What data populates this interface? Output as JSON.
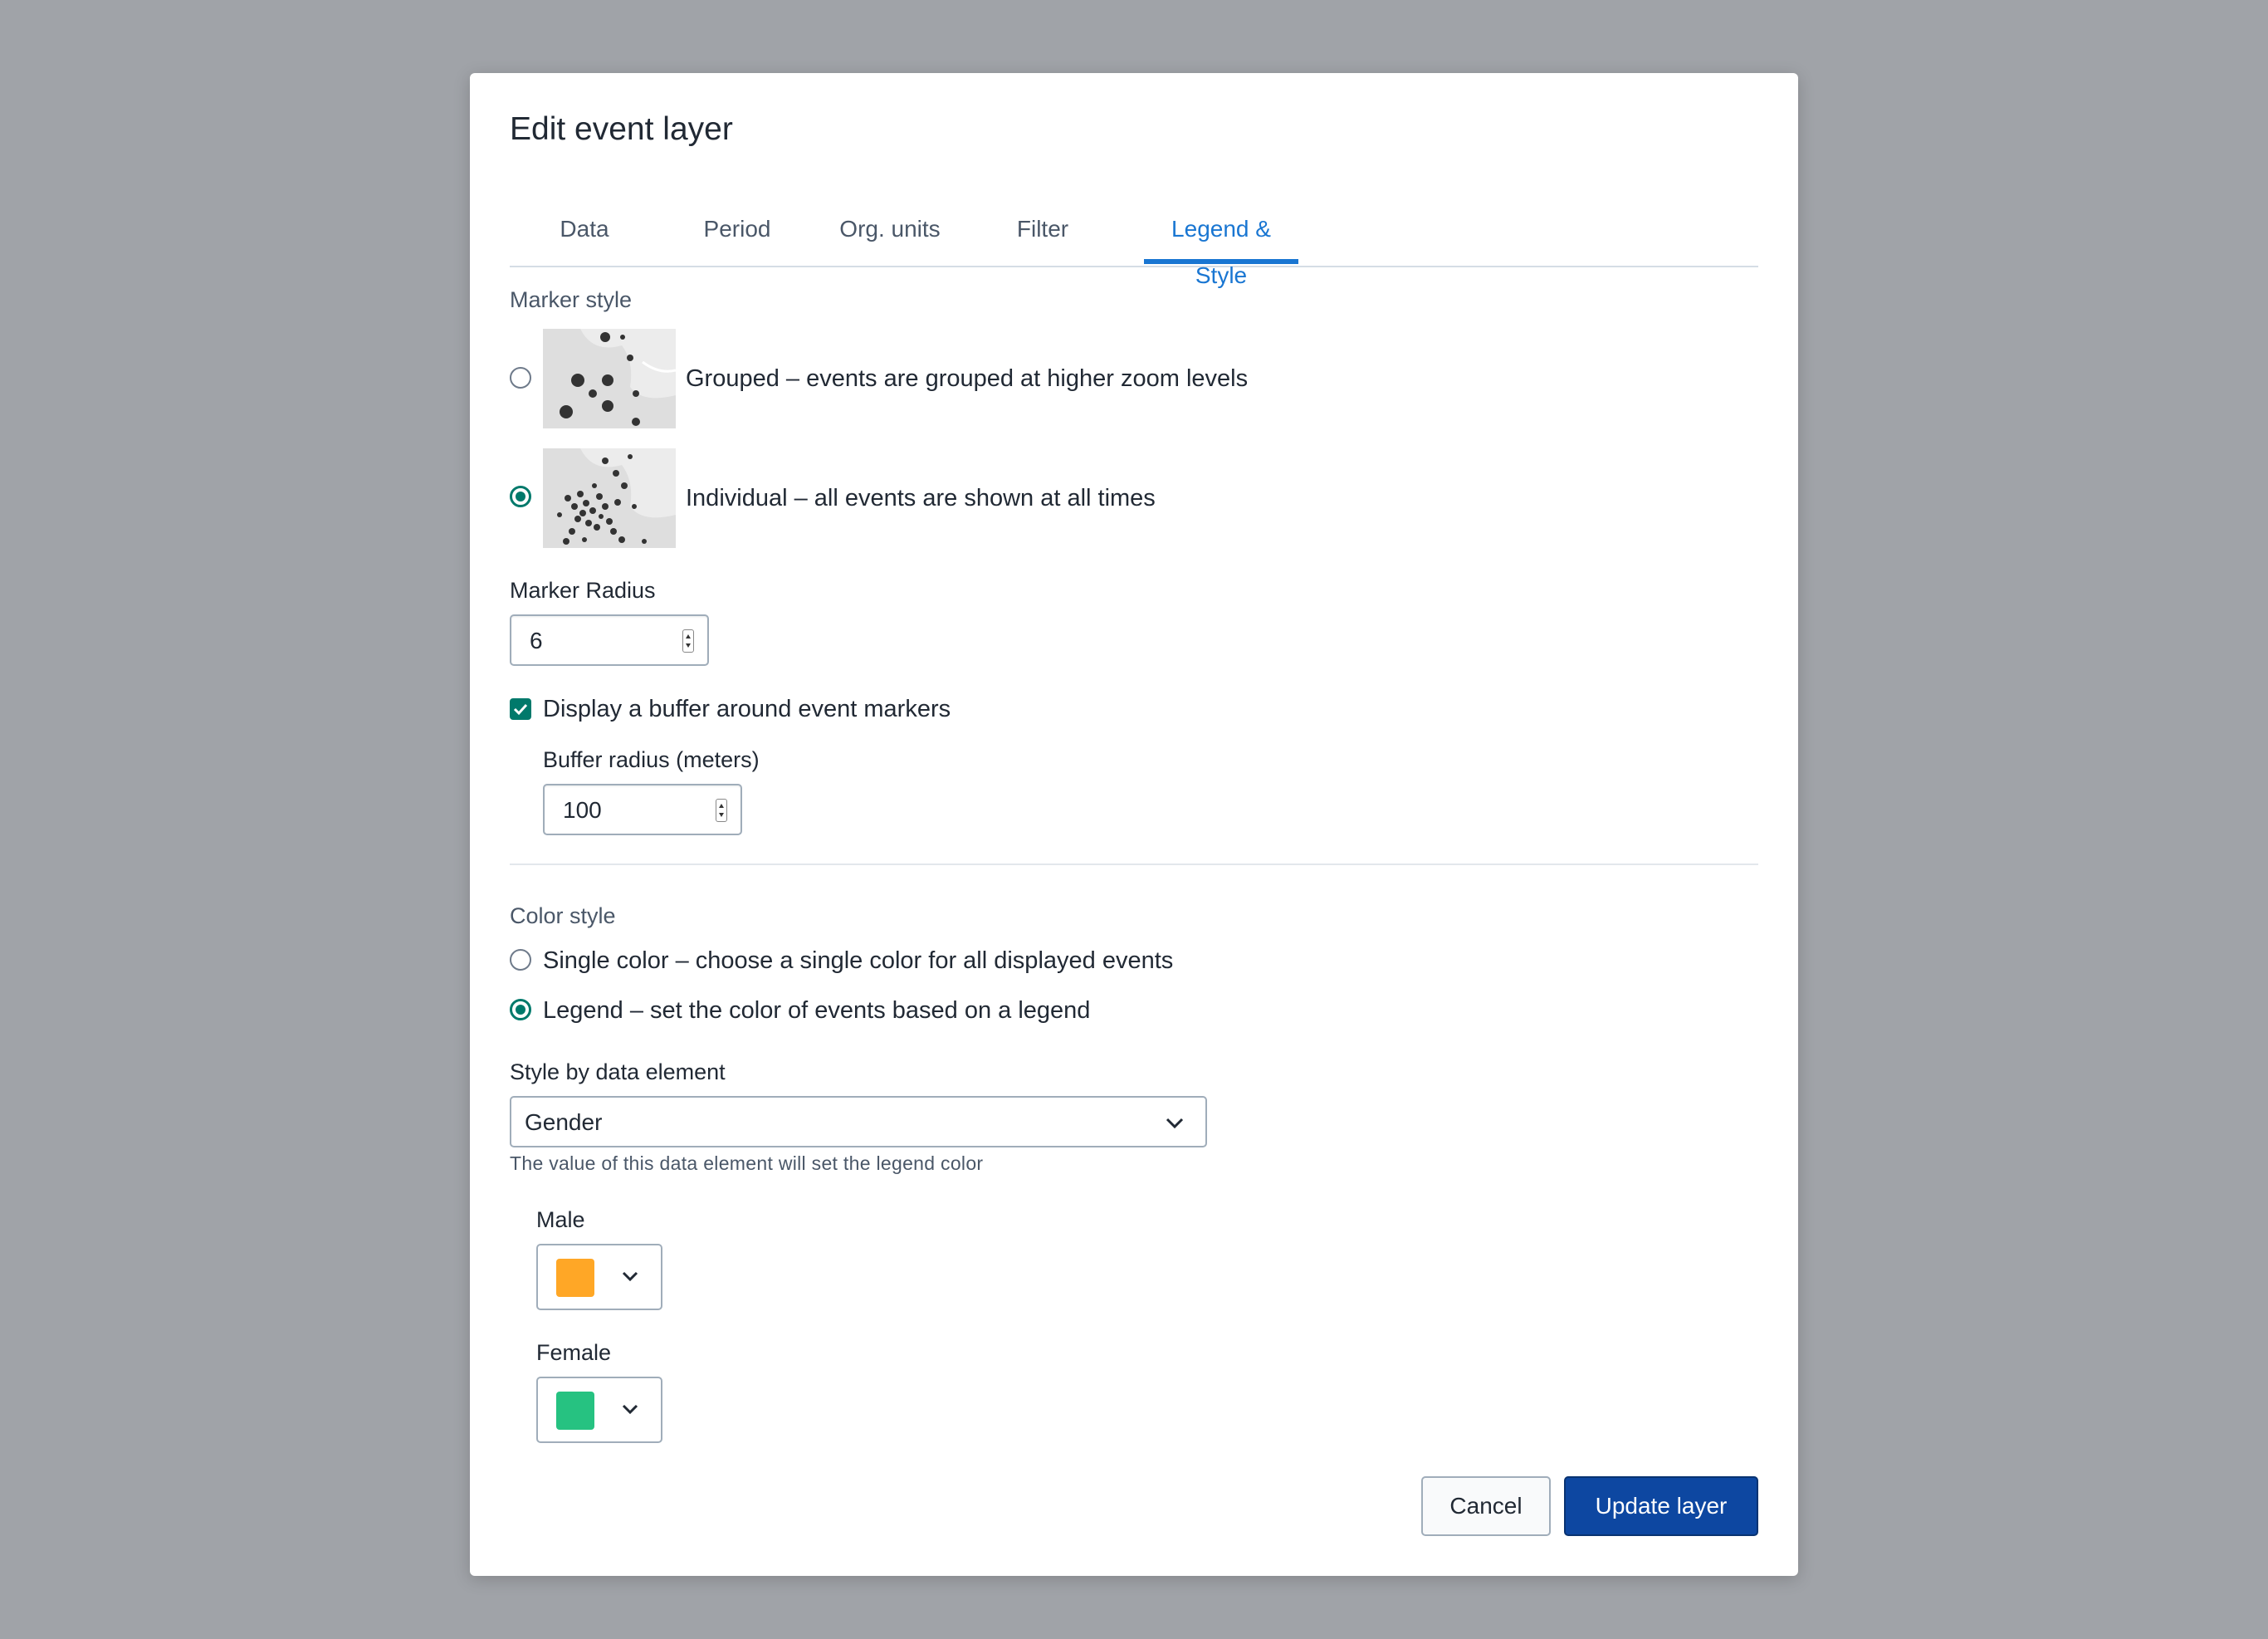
{
  "dialog": {
    "title": "Edit event layer"
  },
  "tabs": [
    {
      "label": "Data"
    },
    {
      "label": "Period"
    },
    {
      "label": "Org. units"
    },
    {
      "label": "Filter"
    },
    {
      "label": "Legend & Style"
    }
  ],
  "active_tab": "Legend & Style",
  "marker_style": {
    "label": "Marker style",
    "options": [
      {
        "label": "Grouped – events are grouped at higher zoom levels",
        "selected": false
      },
      {
        "label": "Individual – all events are shown at all times",
        "selected": true
      }
    ]
  },
  "marker_radius": {
    "label": "Marker Radius",
    "value": "6"
  },
  "buffer": {
    "checkbox_label": "Display a buffer around event markers",
    "checked": true,
    "radius_label": "Buffer radius (meters)",
    "radius_value": "100"
  },
  "color_style": {
    "label": "Color style",
    "options": [
      {
        "label": "Single color – choose a single color for all displayed events",
        "selected": false
      },
      {
        "label": "Legend – set the color of events based on a legend",
        "selected": true
      }
    ]
  },
  "style_by": {
    "label": "Style by data element",
    "value": "Gender",
    "help": "The value of this data element will set the legend color"
  },
  "legend_items": [
    {
      "label": "Male",
      "color": "#ffa726"
    },
    {
      "label": "Female",
      "color": "#26c281"
    }
  ],
  "actions": {
    "cancel": "Cancel",
    "update": "Update layer"
  },
  "colors": {
    "accent": "#1976d2",
    "primary_button": "#0d47a1",
    "radio_checked": "#00796b"
  }
}
